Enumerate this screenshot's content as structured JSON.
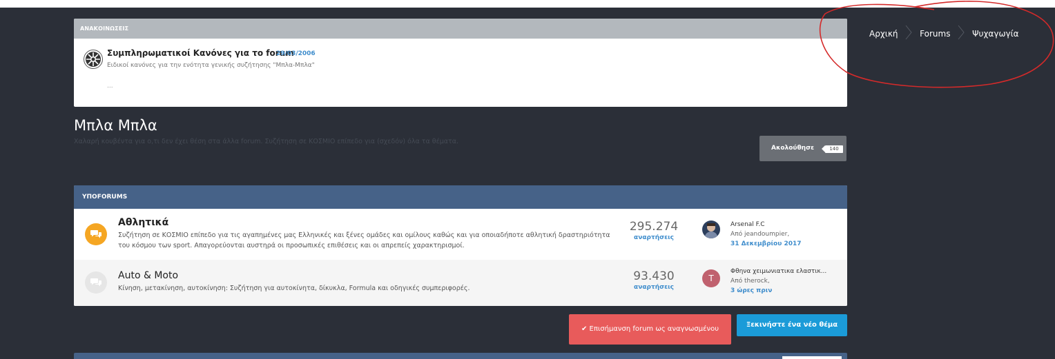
{
  "announcements": {
    "header": "ΑΝΑΚΟΙΝΩΣΕΙΣ",
    "item": {
      "title": "Συμπληρωματικοί Κανόνες για το forum",
      "date": "29/03/2006",
      "description": "Ειδικοί κανόνες για την ενότητα γενικής συζήτησης \"Μπλα-Μπλα\"",
      "more": "..."
    }
  },
  "forum": {
    "title": "Μπλα Μπλα",
    "description": "Χαλαρή κουβέντα για ο,τι δεν έχει θέση στα άλλα forum. Συζήτηση σε ΚΟΣΜΙΟ επίπεδο για (σχεδόν) όλα τα θέματα.",
    "follow_label": "Ακολούθησε",
    "follow_count": "140"
  },
  "subforums": {
    "header": "ΥΠΟFORUMS",
    "rows": [
      {
        "name": "Αθλητικά",
        "description": "Συζήτηση σε ΚΟΣΜΙΟ επίπεδο για τις αγαπημένες μας Ελληνικές και ξένες ομάδες και ομίλους καθώς και για οποιαδήποτε αθλητική δραστηριότητα του κόσμου των sport. Απαγορεύονται αυστηρά οι προσωπικές επιθέσεις και οι απρεπείς χαρακτηρισμοί.",
        "posts": "295.274",
        "posts_label": "αναρτήσεις",
        "last_topic": "Arsenal F.C",
        "last_by": "Από jeandoumpier,",
        "last_when": "31 Δεκεμβρίου 2017",
        "icon_color": "#f5a623"
      },
      {
        "name": "Auto & Moto",
        "description": "Κίνηση, μετακίνηση, αυτοκίνηση: Συζήτηση για αυτοκίνητα, δίκυκλα, Formula και οδηγικές συμπεριφορές.",
        "posts": "93.430",
        "posts_label": "αναρτήσεις",
        "last_topic": "Φθηνα χειμωνιατικα ελαστικ...",
        "last_by": "Από therock,",
        "last_when": "3 ώρες πριν",
        "avatar_letter": "T",
        "avatar_color": "#c0616e",
        "icon_color": "#e6e6e6"
      }
    ]
  },
  "buttons": {
    "mark_read": "Επισήμανση forum ως αναγνωσμένου",
    "new_topic": "Ξεκινήστε ένα νέο θέμα"
  },
  "breadcrumb": [
    "Αρχική",
    "Forums",
    "Ψυχαγωγία"
  ],
  "colors": {
    "background": "#2b2f38",
    "accent_blue": "#3f8dcc",
    "subforum_header": "#466288",
    "mark_read_button": "#e85b5b",
    "new_topic_button": "#1b9bd8",
    "annotation_ring": "#d42a2a"
  }
}
